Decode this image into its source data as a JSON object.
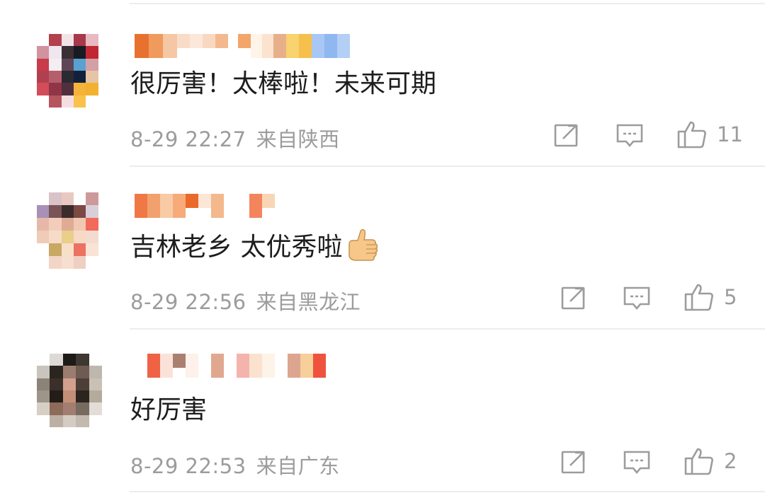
{
  "comments": [
    {
      "text": "很厉害！太棒啦！未来可期",
      "date": "8-29 22:27",
      "region": "来自陕西",
      "likes": "11",
      "actions": {
        "repost": "repost-icon",
        "reply": "comment-icon",
        "like": "thumbs-up-icon"
      }
    },
    {
      "text": "吉林老乡 太优秀啦",
      "date": "8-29 22:56",
      "region": "来自黑龙江",
      "likes": "5",
      "emoji": "thumbs-up-emoji",
      "actions": {
        "repost": "repost-icon",
        "reply": "comment-icon",
        "like": "thumbs-up-icon"
      }
    },
    {
      "text": "好厉害",
      "date": "8-29 22:53",
      "region": "来自广东",
      "likes": "2",
      "actions": {
        "repost": "repost-icon",
        "reply": "comment-icon",
        "like": "thumbs-up-icon"
      }
    }
  ],
  "colors": {
    "text": "#1d1d1d",
    "meta": "#9c9c9c",
    "divider": "#ececec"
  },
  "avatars_pixelated": true,
  "usernames_pixelated": true
}
